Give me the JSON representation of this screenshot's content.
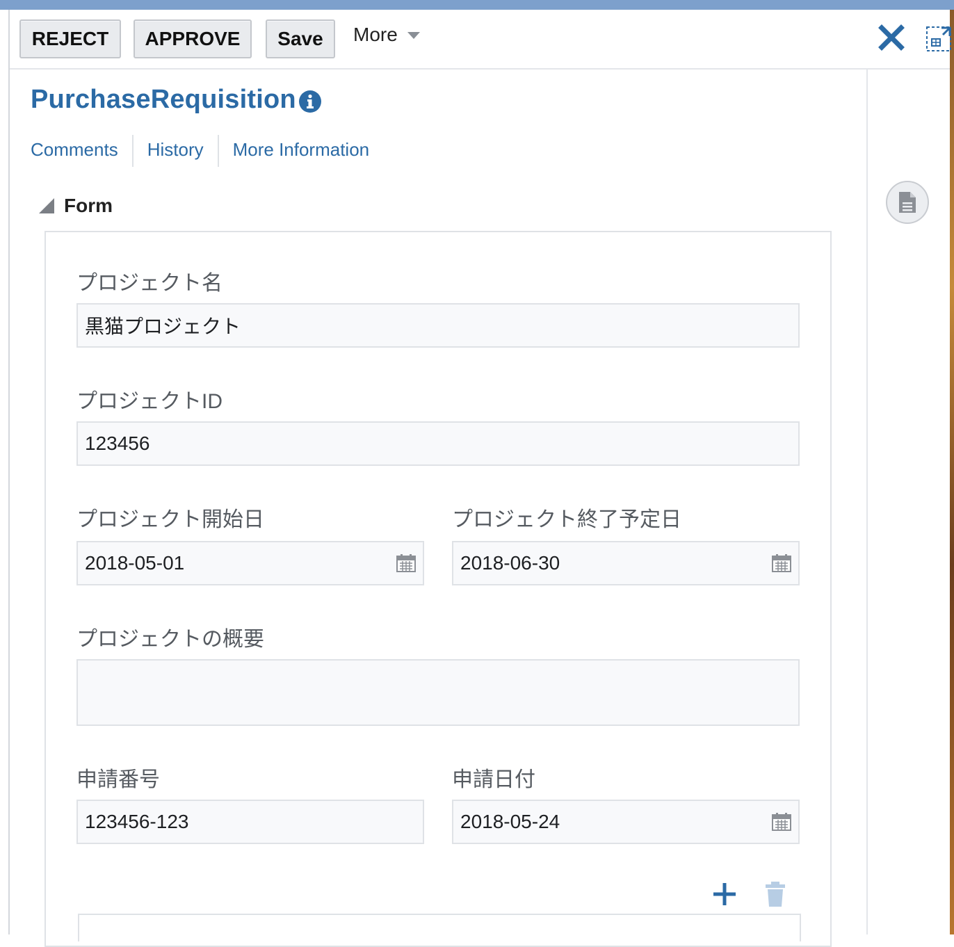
{
  "toolbar": {
    "reject_label": "REJECT",
    "approve_label": "APPROVE",
    "save_label": "Save",
    "more_label": "More"
  },
  "header": {
    "title": "PurchaseRequisition"
  },
  "tabs": [
    {
      "label": "Comments"
    },
    {
      "label": "History"
    },
    {
      "label": "More Information"
    }
  ],
  "section": {
    "label": "Form"
  },
  "form": {
    "project_name_label": "プロジェクト名",
    "project_name_value": "黒猫プロジェクト",
    "project_id_label": "プロジェクトID",
    "project_id_value": "123456",
    "start_date_label": "プロジェクト開始日",
    "start_date_value": "2018-05-01",
    "end_date_label": "プロジェクト終了予定日",
    "end_date_value": "2018-06-30",
    "summary_label": "プロジェクトの概要",
    "summary_value": "",
    "request_no_label": "申請番号",
    "request_no_value": "123456-123",
    "request_date_label": "申請日付",
    "request_date_value": "2018-05-24"
  },
  "colors": {
    "accent": "#2b6aa5",
    "top_strip": "#7da0cc",
    "button_bg": "#e9ebee",
    "field_bg": "#f8f9fb"
  },
  "icons": [
    "close-icon",
    "expand-icon",
    "info-icon",
    "document-icon",
    "calendar-icon",
    "add-icon",
    "delete-icon",
    "chevron-down-icon",
    "collapse-triangle-icon"
  ]
}
